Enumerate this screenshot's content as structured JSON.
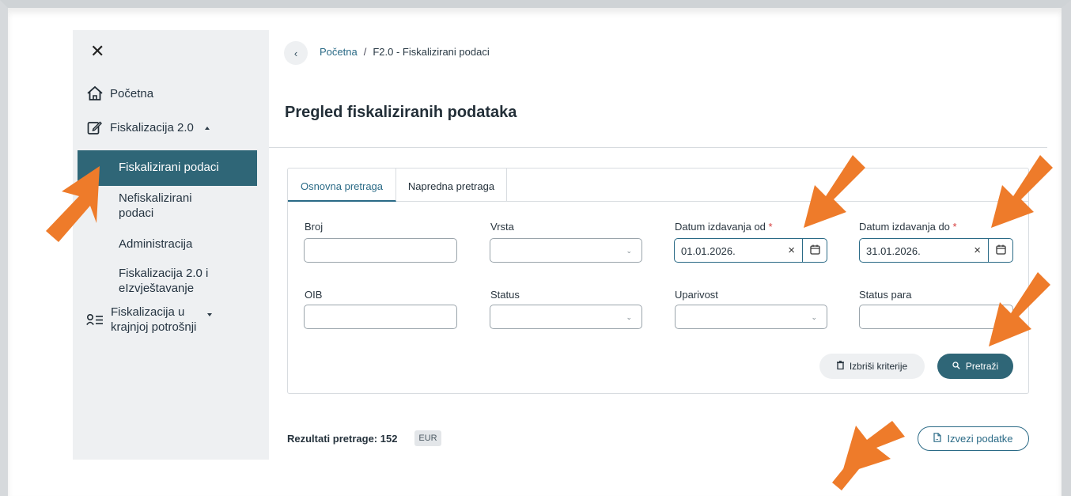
{
  "sidebar": {
    "items": [
      {
        "label": "Početna",
        "icon": "home-icon"
      },
      {
        "label": "Fiskalizacija 2.0",
        "icon": "edit-document-icon",
        "expanded": true
      },
      {
        "label": "Fiskalizirani podaci",
        "active": true
      },
      {
        "label": "Nefiskalizirani podaci"
      },
      {
        "label": "Administracija"
      },
      {
        "label": "Fiskalizacija 2.0 i eIzvještavanje"
      },
      {
        "label": "Fiskalizacija u krajnjoj potrošnji",
        "icon": "user-list-icon",
        "expanded": false
      }
    ],
    "labels": {
      "home": "Početna",
      "fisk20": "Fiskalizacija 2.0",
      "fiskalizirani": "Fiskalizirani podaci",
      "nefisk_1": "Nefiskalizirani",
      "nefisk_2": "podaci",
      "administracija": "Administracija",
      "fisk_ei_1": "Fiskalizacija 2.0 i",
      "fisk_ei_2": "eIzvještavanje",
      "krajnja_1": "Fiskalizacija u",
      "krajnja_2": "krajnjoj potrošnji"
    }
  },
  "breadcrumb": {
    "home": "Početna",
    "separator": "/",
    "current": "F2.0 - Fiskalizirani podaci"
  },
  "page_title": "Pregled fiskaliziranih podataka",
  "tabs": {
    "basic": "Osnovna pretraga",
    "advanced": "Napredna pretraga"
  },
  "form": {
    "broj": {
      "label": "Broj",
      "value": ""
    },
    "vrsta": {
      "label": "Vrsta",
      "value": ""
    },
    "datum_od": {
      "label": "Datum izdavanja od",
      "required_mark": "*",
      "value": "01.01.2026."
    },
    "datum_do": {
      "label": "Datum izdavanja do",
      "required_mark": "*",
      "value": "31.01.2026."
    },
    "oib": {
      "label": "OIB",
      "value": ""
    },
    "status": {
      "label": "Status",
      "value": ""
    },
    "uparivost": {
      "label": "Uparivost",
      "value": ""
    },
    "status_para": {
      "label": "Status para",
      "value": ""
    }
  },
  "buttons": {
    "clear": "Izbriši kriterije",
    "search": "Pretraži",
    "export": "Izvezi podatke"
  },
  "results": {
    "label": "Rezultati pretrage: 152",
    "currency": "EUR"
  },
  "colors": {
    "accent": "#2f6677",
    "link": "#2a6a86",
    "required": "#d63b3b",
    "annotation_arrow": "#ee7b2a",
    "sidebar_bg": "#eef0f2"
  }
}
